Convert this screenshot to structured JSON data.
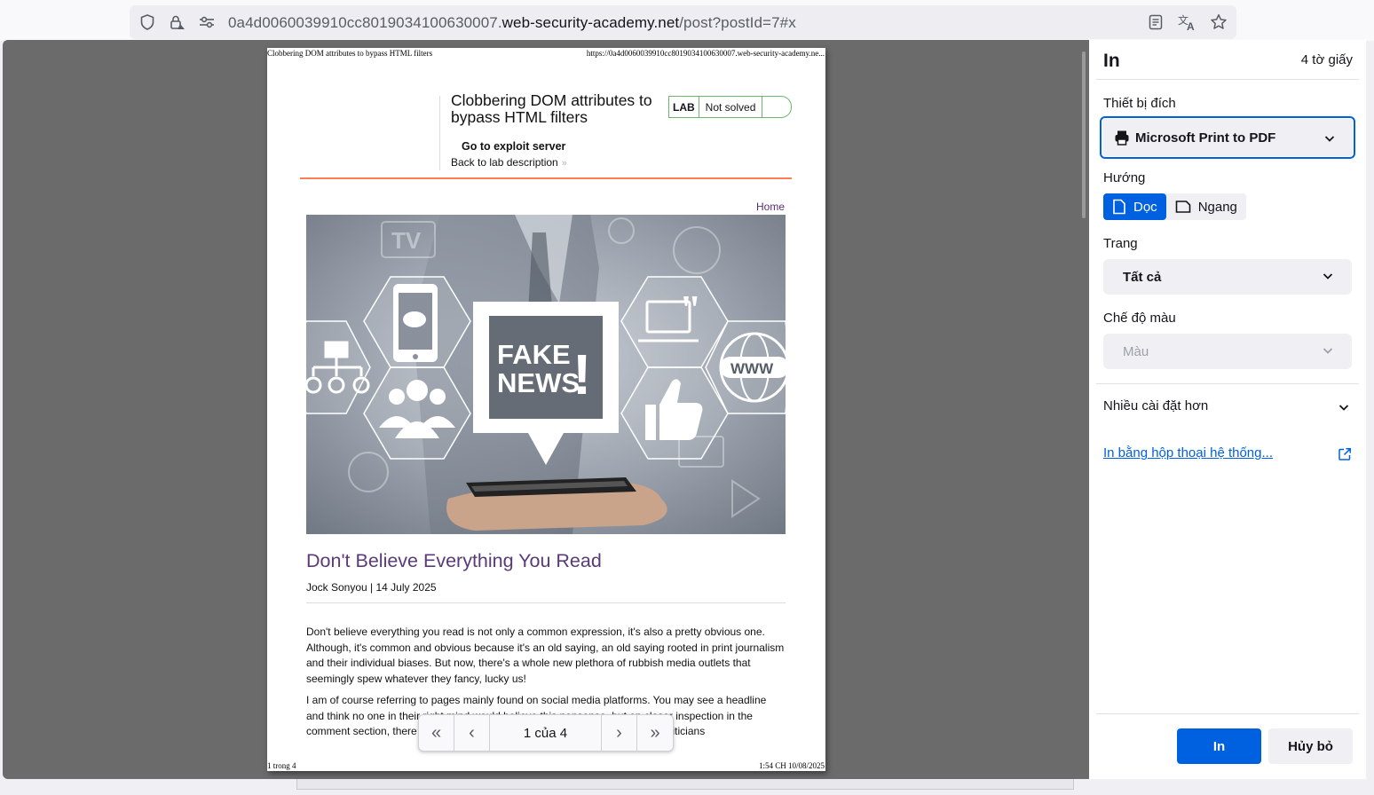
{
  "urlbar": {
    "url_prefix": "0a4d0060039910cc8019034100630007.",
    "url_domain": "web-security-academy.net",
    "url_suffix": "/post?postId=7#x"
  },
  "print_preview": {
    "header_left": "Clobbering DOM attributes to bypass HTML filters",
    "header_right": "https://0a4d0060039910cc8019034100630007.web-security-academy.ne...",
    "footer_left": "1 trong 4",
    "footer_right": "1:54 CH 10/08/2025",
    "lab": {
      "title": "Clobbering DOM attributes to bypass HTML filters",
      "badge_label": "LAB",
      "status": "Not solved",
      "exploit_link": "Go to exploit server",
      "back_link": "Back to lab description",
      "back_chevron": "»"
    },
    "nav": {
      "home": "Home"
    },
    "image": {
      "headline_line1": "FAKE",
      "headline_line2": "NEWS",
      "exclamation": "!",
      "www": "WWW",
      "tv": "TV"
    },
    "post": {
      "title": "Don't Believe Everything You Read",
      "meta": "Jock Sonyou | 14 July 2025",
      "paragraphs": [
        "Don't believe everything you read is not only a common expression, it's also a pretty obvious one. Although, it's common and obvious because it's an old saying, an old saying rooted in print journalism and their individual biases. But now, there's a whole new plethora of rubbish media outlets that seemingly spew whatever they fancy, lucky us!",
        "I am of course referring to pages mainly found on social media platforms. You may see a headline and think no one in their right mind would believe this nonsense, but on closer inspection in the comment section, there are plenty who do and it's a problem of the day is. Politicians"
      ]
    },
    "pager": {
      "first": "«",
      "prev": "‹",
      "page_label": "1 của 4",
      "next": "›",
      "last": "»"
    }
  },
  "print_panel": {
    "title": "In",
    "sheets": "4 tờ giấy",
    "destination_label": "Thiết bị đích",
    "destination_value": "Microsoft Print to PDF",
    "orientation_label": "Hướng",
    "orientation_portrait": "Dọc",
    "orientation_landscape": "Ngang",
    "pages_label": "Trang",
    "pages_value": "Tất cả",
    "color_label": "Chế độ màu",
    "color_value": "Màu",
    "more_settings": "Nhiều cài đặt hơn",
    "system_dialog_link": "In bằng hộp thoại hệ thống...",
    "print_button": "In",
    "cancel_button": "Hủy bỏ"
  },
  "colors": {
    "accent": "#0061e0",
    "lab_green": "#69b86b",
    "orange_rule": "#ff6633",
    "post_title": "#5a3a78"
  },
  "icons": [
    "shield-icon",
    "lock-icon",
    "site-permissions-icon",
    "reader-view-icon",
    "translate-icon",
    "bookmark-star-icon",
    "printer-icon",
    "chevron-down-icon",
    "portrait-page-icon",
    "landscape-page-icon",
    "external-link-icon"
  ]
}
